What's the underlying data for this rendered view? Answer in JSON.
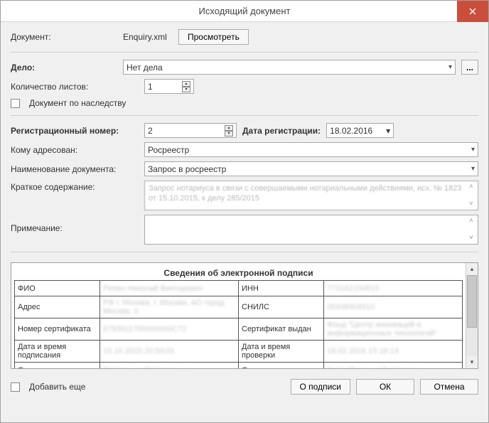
{
  "window": {
    "title": "Исходящий документ"
  },
  "doc": {
    "label": "Документ:",
    "filename": "Enquiry.xml",
    "view_btn": "Просмотреть"
  },
  "case": {
    "label": "Дело:",
    "value": "Нет дела",
    "more_btn": "..."
  },
  "sheets": {
    "label": "Количество листов:",
    "value": "1"
  },
  "inherit": {
    "label": "Документ по наследству"
  },
  "reg": {
    "num_label": "Регистрационный номер:",
    "num_value": "2",
    "date_label": "Дата регистрации:",
    "date_value": "18.02.2016"
  },
  "addressee": {
    "label": "Кому адресован:",
    "value": "Росреестр"
  },
  "docname": {
    "label": "Наименование документа:",
    "value": "Запрос в росреестр"
  },
  "summary": {
    "label": "Краткое содержание:",
    "value": "Запрос нотариуса в связи с совершаемыми нотариальными действиями, исх. № 1823 от 15.10.2015, к делу 285/2015"
  },
  "note": {
    "label": "Примечание:",
    "value": ""
  },
  "sig": {
    "title": "Сведения об электронной подписи",
    "rows": [
      {
        "l1": "ФИО",
        "v1": "Репин Николай Викторович",
        "l2": "ИНН",
        "v2": "773162150815"
      },
      {
        "l1": "Адрес",
        "v1": "РФ г. Москва, г. Москва, АО город Москва, 0",
        "l2": "СНИЛС",
        "v2": "05448404510"
      },
      {
        "l1": "Номер сертификата",
        "v1": "6783911700000000C72",
        "l2": "Сертификат выдан",
        "v2": "Фонд \"Центр инноваций и информационных технологий\""
      },
      {
        "l1": "Дата и время подписания",
        "v1": "15.10.2015 20:50:01",
        "l2": "Дата и время проверки",
        "v2": "18.02.2016 15:16:13"
      },
      {
        "l1": "Статус подписи",
        "v1": "Подпись действительна",
        "l2": "Статус",
        "v2": "Сертификат действителен"
      }
    ]
  },
  "footer": {
    "add_more": "Добавить еще",
    "about_sig": "О подписи",
    "ok": "ОК",
    "cancel": "Отмена"
  }
}
